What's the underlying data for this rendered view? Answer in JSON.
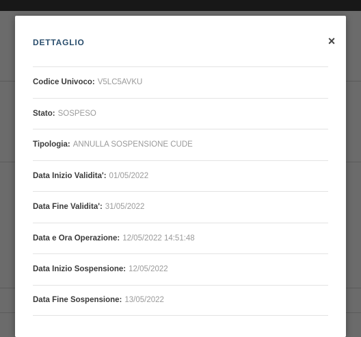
{
  "modal": {
    "title": "DETTAGLIO",
    "close_label": "×",
    "rows": [
      {
        "label": "Codice Univoco:",
        "value": "V5LC5AVKU"
      },
      {
        "label": "Stato:",
        "value": "SOSPESO"
      },
      {
        "label": "Tipologia:",
        "value": "ANNULLA SOSPENSIONE CUDE"
      },
      {
        "label": "Data Inizio Validita':",
        "value": "01/05/2022"
      },
      {
        "label": "Data Fine Validita':",
        "value": "31/05/2022"
      },
      {
        "label": "Data e Ora Operazione:",
        "value": "12/05/2022 14:51:48"
      },
      {
        "label": "Data Inizio Sospensione:",
        "value": "12/05/2022"
      },
      {
        "label": "Data Fine Sospensione:",
        "value": "13/05/2022"
      }
    ]
  },
  "colors": {
    "title": "#2a4e6d",
    "label": "#3a3a3a",
    "value": "#9a9a9a",
    "overlay": "rgba(0,0,0,0.58)"
  },
  "icons": {
    "close": "close-icon"
  }
}
